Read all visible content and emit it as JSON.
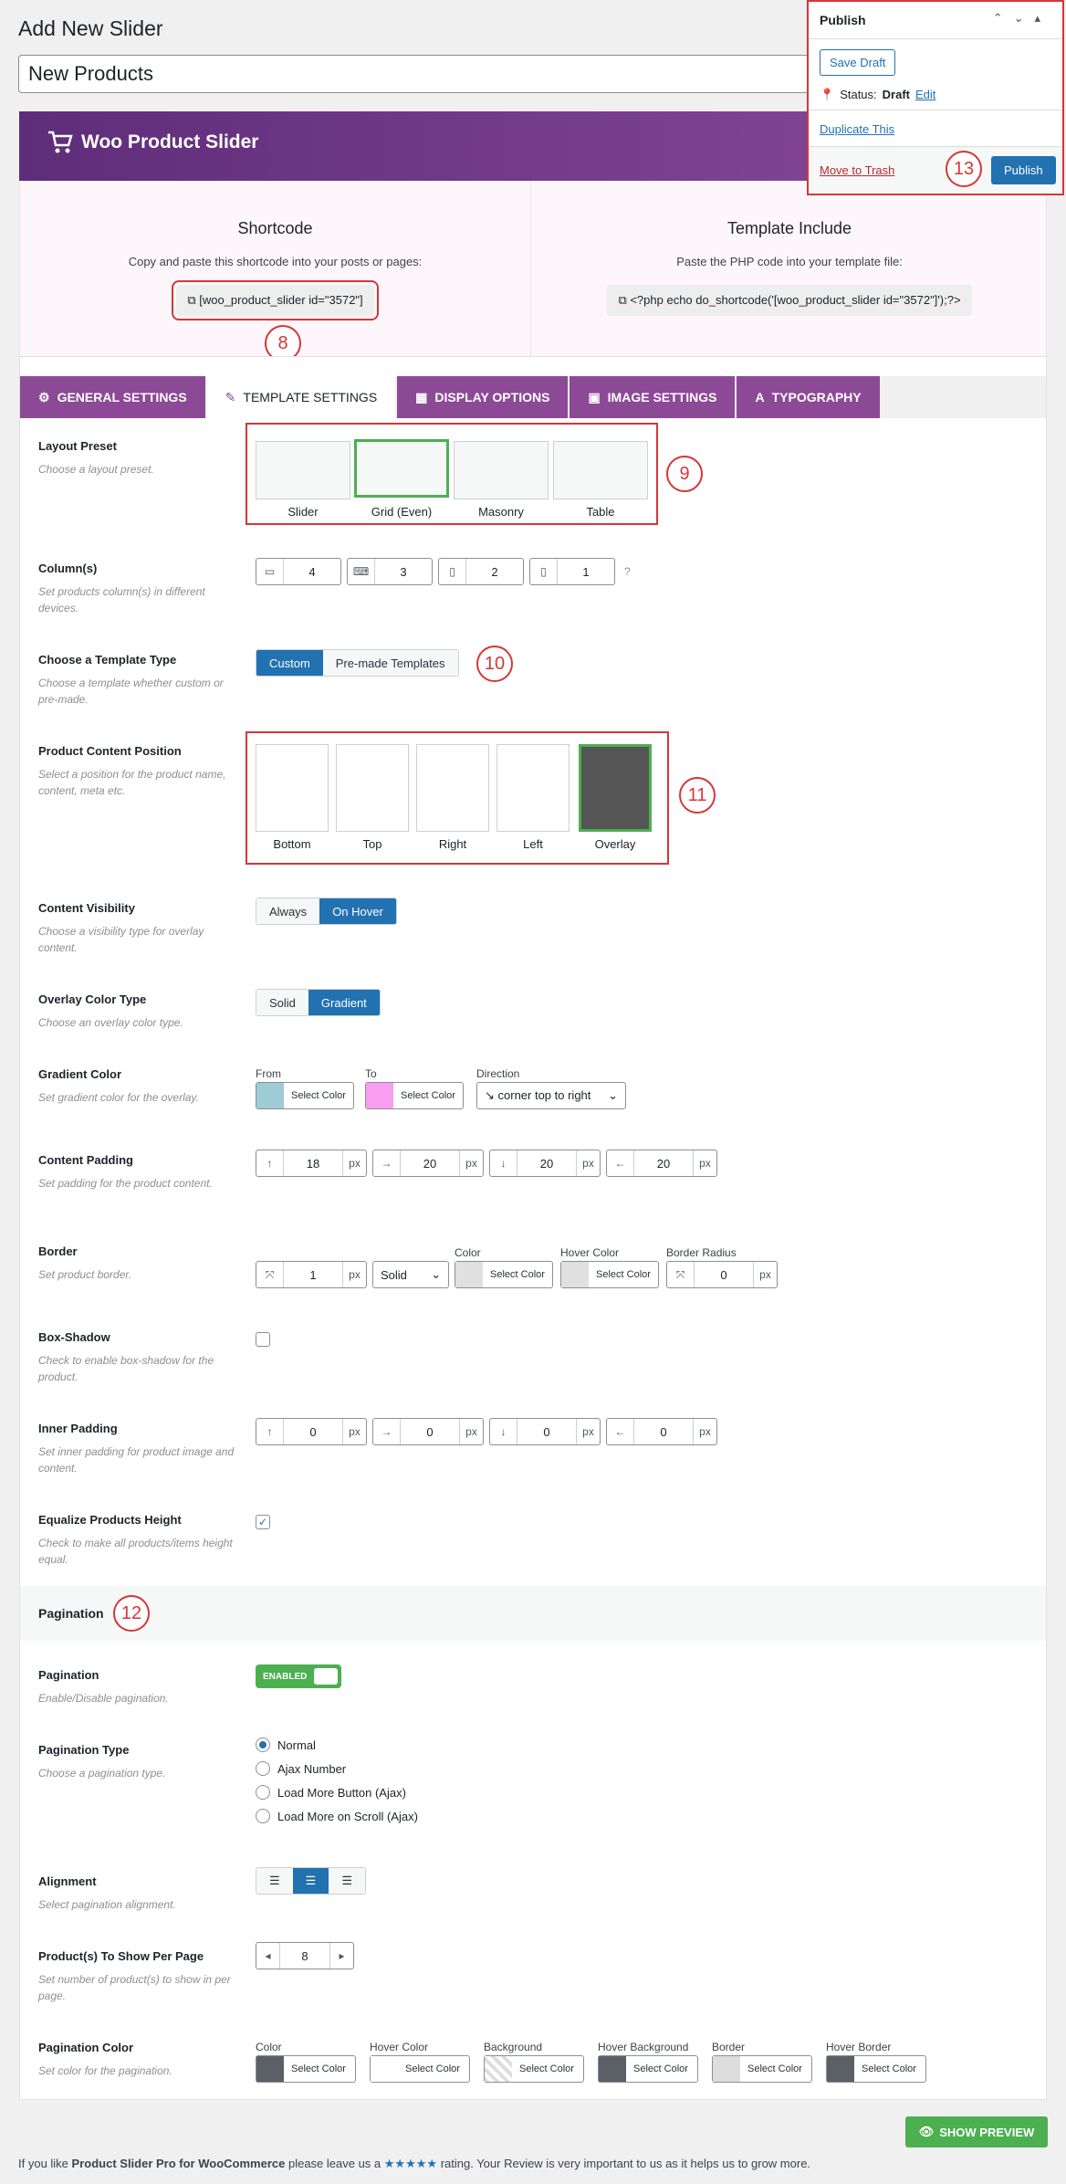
{
  "page": {
    "title": "Add New Slider",
    "post_title": "New Products"
  },
  "banner": {
    "brand": "Woo Product Slider"
  },
  "shortcode": {
    "heading": "Shortcode",
    "desc": "Copy and paste this shortcode into your posts or pages:",
    "code": "[woo_product_slider id=\"3572\"]"
  },
  "template_include": {
    "heading": "Template Include",
    "desc": "Paste the PHP code into your template file:",
    "code": "<?php echo do_shortcode('[woo_product_slider id=\"3572\"]');?>"
  },
  "tabs": [
    {
      "label": "GENERAL SETTINGS",
      "icon": "gear-icon"
    },
    {
      "label": "TEMPLATE SETTINGS",
      "icon": "brush-icon"
    },
    {
      "label": "DISPLAY OPTIONS",
      "icon": "grid-icon"
    },
    {
      "label": "IMAGE SETTINGS",
      "icon": "image-icon"
    },
    {
      "label": "TYPOGRAPHY",
      "icon": "font-icon"
    }
  ],
  "layout_preset": {
    "label": "Layout Preset",
    "desc": "Choose a layout preset.",
    "options": [
      "Slider",
      "Grid (Even)",
      "Masonry",
      "Table"
    ],
    "selected": "Grid (Even)"
  },
  "columns": {
    "label": "Column(s)",
    "desc": "Set products column(s) in different devices.",
    "values": [
      "4",
      "3",
      "2",
      "1"
    ]
  },
  "template_type": {
    "label": "Choose a Template Type",
    "desc": "Choose a template whether custom or pre-made.",
    "options": [
      "Custom",
      "Pre-made Templates"
    ],
    "selected": "Custom"
  },
  "content_position": {
    "label": "Product Content Position",
    "desc": "Select a position for the product name, content, meta etc.",
    "options": [
      "Bottom",
      "Top",
      "Right",
      "Left",
      "Overlay"
    ],
    "selected": "Overlay"
  },
  "content_visibility": {
    "label": "Content Visibility",
    "desc": "Choose a visibility type for overlay content.",
    "options": [
      "Always",
      "On Hover"
    ],
    "selected": "On Hover"
  },
  "overlay_color_type": {
    "label": "Overlay Color Type",
    "desc": "Choose an overlay color type.",
    "options": [
      "Solid",
      "Gradient"
    ],
    "selected": "Gradient"
  },
  "gradient_color": {
    "label": "Gradient Color",
    "desc": "Set gradient color for the overlay.",
    "from_label": "From",
    "to_label": "To",
    "direction_label": "Direction",
    "from_color": "#9ecbd6",
    "to_color": "#f79ef0",
    "select_text": "Select Color",
    "direction": "↘ corner top to right"
  },
  "content_padding": {
    "label": "Content Padding",
    "desc": "Set padding for the product content.",
    "values": [
      "18",
      "20",
      "20",
      "20"
    ],
    "unit": "px"
  },
  "border": {
    "label": "Border",
    "desc": "Set product border.",
    "width": "1",
    "unit": "px",
    "style": "Solid",
    "color_label": "Color",
    "hover_label": "Hover Color",
    "radius_label": "Border Radius",
    "radius": "0",
    "select_text": "Select Color"
  },
  "box_shadow": {
    "label": "Box-Shadow",
    "desc": "Check to enable box-shadow for the product."
  },
  "inner_padding": {
    "label": "Inner Padding",
    "desc": "Set inner padding for product image and content.",
    "values": [
      "0",
      "0",
      "0",
      "0"
    ],
    "unit": "px"
  },
  "equalize": {
    "label": "Equalize Products Height",
    "desc": "Check to make all products/items height equal."
  },
  "pagination_section": {
    "title": "Pagination"
  },
  "pagination": {
    "label": "Pagination",
    "desc": "Enable/Disable pagination.",
    "toggle": "ENABLED"
  },
  "pagination_type": {
    "label": "Pagination Type",
    "desc": "Choose a pagination type.",
    "options": [
      "Normal",
      "Ajax Number",
      "Load More Button (Ajax)",
      "Load More on Scroll (Ajax)"
    ],
    "selected": "Normal"
  },
  "alignment": {
    "label": "Alignment",
    "desc": "Select pagination alignment."
  },
  "per_page": {
    "label": "Product(s) To Show Per Page",
    "desc": "Set number of product(s) to show in per page.",
    "value": "8"
  },
  "pagination_color": {
    "label": "Pagination Color",
    "desc": "Set color for the pagination.",
    "items": [
      {
        "label": "Color",
        "color": "#5b6066"
      },
      {
        "label": "Hover Color",
        "color": "#ffffff"
      },
      {
        "label": "Background",
        "color": "#e0e0e0"
      },
      {
        "label": "Hover Background",
        "color": "#5b6066"
      },
      {
        "label": "Border",
        "color": "#dddddd"
      },
      {
        "label": "Hover Border",
        "color": "#5b6066"
      }
    ],
    "select_text": "Select Color"
  },
  "publish": {
    "title": "Publish",
    "save_draft": "Save Draft",
    "status_label": "Status:",
    "status_value": "Draft",
    "edit": "Edit",
    "duplicate": "Duplicate This",
    "trash": "Move to Trash",
    "publish_btn": "Publish"
  },
  "markers": {
    "m8": "8",
    "m9": "9",
    "m10": "10",
    "m11": "11",
    "m12": "12",
    "m13": "13"
  },
  "preview_btn": "SHOW PREVIEW",
  "footer": {
    "pre": "If you like",
    "product": "Product Slider Pro for WooCommerce",
    "mid": "please leave us a",
    "stars": "★★★★★",
    "post": "rating. Your Review is very important to us as it helps us to grow more."
  }
}
